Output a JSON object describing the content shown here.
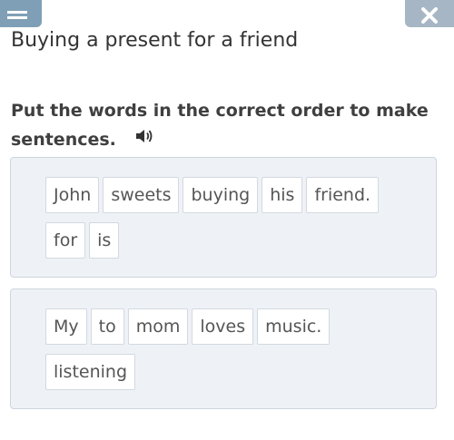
{
  "header": {
    "menu_icon": "hamburger-menu-icon",
    "close_icon": "close-icon",
    "title": "Buying a present for a friend"
  },
  "task": {
    "instruction": "Put the words in the correct order to make sentences.",
    "audio_icon": "speaker-icon"
  },
  "sentences": [
    {
      "words": [
        "John",
        "sweets",
        "buying",
        "his",
        "friend.",
        "for",
        "is"
      ]
    },
    {
      "words": [
        "My",
        "to",
        "mom",
        "loves",
        "music.",
        "listening"
      ]
    }
  ],
  "colors": {
    "menu_button": "#7f9fb6",
    "close_button": "#a6b6c4",
    "panel_background": "#eef2f7",
    "panel_border": "#ccd5df"
  }
}
